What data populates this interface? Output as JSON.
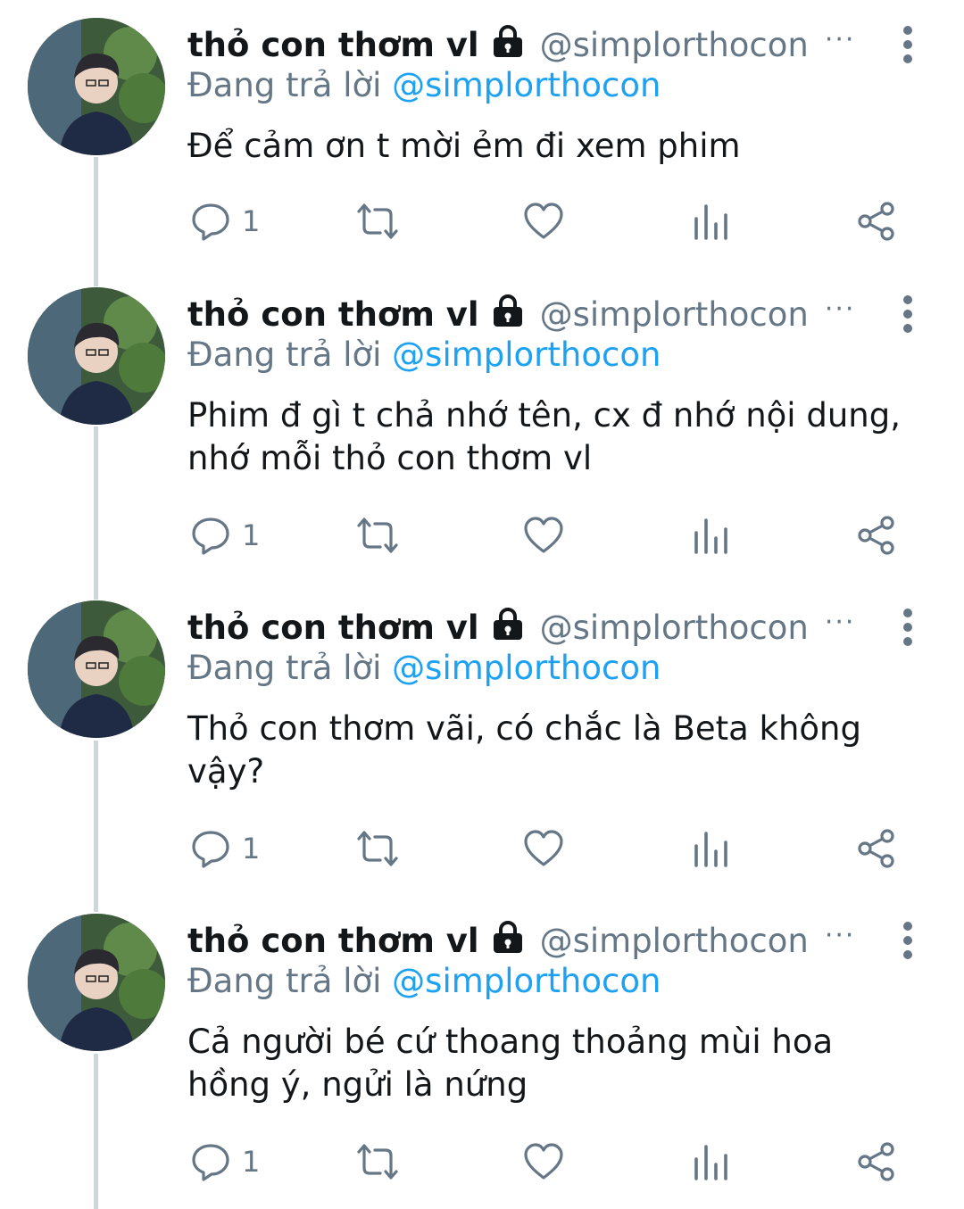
{
  "colors": {
    "text": "#14171a",
    "muted": "#657786",
    "accent": "#1da1f2",
    "thread_line": "#ccd6dd"
  },
  "tweets": [
    {
      "display_name": "thỏ con thơm vl",
      "handle": "@simplorthocon",
      "more": "···",
      "reply_prefix": "Đang trả lời",
      "reply_mention": "@simplorthocon",
      "text": "Để cảm ơn t mời ẻm đi xem phim",
      "reply_count": "1"
    },
    {
      "display_name": "thỏ con thơm vl",
      "handle": "@simplorthocon",
      "more": "···",
      "reply_prefix": "Đang trả lời",
      "reply_mention": "@simplorthocon",
      "text": "Phim đ gì t chả nhớ tên, cx đ nhớ nội dung, nhớ mỗi thỏ con thơm vl",
      "reply_count": "1"
    },
    {
      "display_name": "thỏ con thơm vl",
      "handle": "@simplorthocon",
      "more": "···",
      "reply_prefix": "Đang trả lời",
      "reply_mention": "@simplorthocon",
      "text": "Thỏ con thơm vãi, có chắc là Beta không vậy?",
      "reply_count": "1"
    },
    {
      "display_name": "thỏ con thơm vl",
      "handle": "@simplorthocon",
      "more": "···",
      "reply_prefix": "Đang trả lời",
      "reply_mention": "@simplorthocon",
      "text": "Cả người bé cứ thoang thoảng mùi hoa hồng ý, ngửi là nứng",
      "reply_count": "1"
    }
  ],
  "icons": {
    "lock": "lock-icon",
    "reply": "reply-icon",
    "retweet": "retweet-icon",
    "like": "heart-icon",
    "analytics": "analytics-icon",
    "share": "share-icon",
    "more": "kebab-menu-icon"
  }
}
